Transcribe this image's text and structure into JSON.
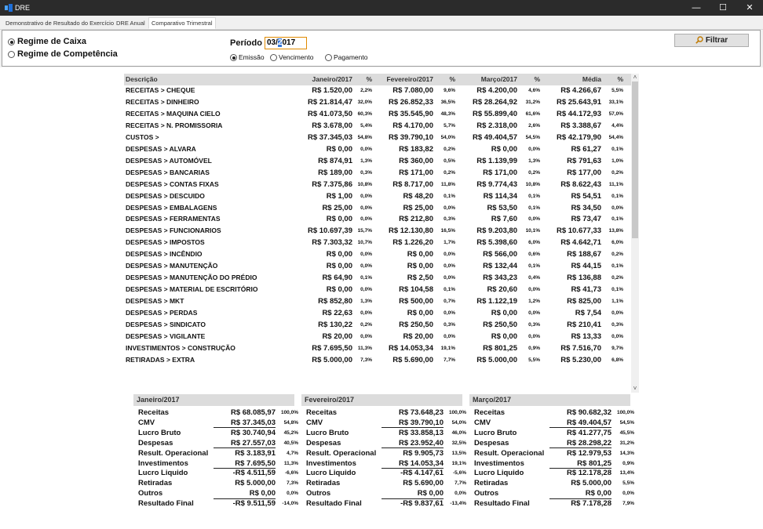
{
  "window": {
    "title": "DRE",
    "minimize": "—",
    "maximize": "☐",
    "close": "✕"
  },
  "tabs": [
    "Demonstrativo de Resultado do Exercício",
    "DRE Anual",
    "Comparativo Trimestral"
  ],
  "filters": {
    "regime_caixa": "Regime de Caixa",
    "regime_competencia": "Regime de Competência",
    "periodo_label": "Período",
    "periodo_value_a": "03/",
    "periodo_value_sel": "2",
    "periodo_value_b": "017",
    "emissao": "Emissão",
    "vencimento": "Vencimento",
    "pagamento": "Pagamento",
    "filtrar": "Filtrar"
  },
  "grid": {
    "headers": [
      "Descrição",
      "Janeiro/2017",
      "%",
      "Fevereiro/2017",
      "%",
      "Março/2017",
      "%",
      "Média",
      "%"
    ],
    "rows": [
      [
        "RECEITAS > CHEQUE",
        "R$ 1.520,00",
        "2,2%",
        "R$ 7.080,00",
        "9,6%",
        "R$ 4.200,00",
        "4,6%",
        "R$ 4.266,67",
        "5,5%"
      ],
      [
        "RECEITAS > DINHEIRO",
        "R$ 21.814,47",
        "32,0%",
        "R$ 26.852,33",
        "36,5%",
        "R$ 28.264,92",
        "31,2%",
        "R$ 25.643,91",
        "33,1%"
      ],
      [
        "RECEITAS > MAQUINA CIELO",
        "R$ 41.073,50",
        "60,3%",
        "R$ 35.545,90",
        "48,3%",
        "R$ 55.899,40",
        "61,6%",
        "R$ 44.172,93",
        "57,0%"
      ],
      [
        "RECEITAS > N. PROMISSORIA",
        "R$ 3.678,00",
        "5,4%",
        "R$ 4.170,00",
        "5,7%",
        "R$ 2.318,00",
        "2,6%",
        "R$ 3.388,67",
        "4,4%"
      ],
      [
        "CUSTOS >",
        "R$ 37.345,03",
        "54,8%",
        "R$ 39.790,10",
        "54,0%",
        "R$ 49.404,57",
        "54,5%",
        "R$ 42.179,90",
        "54,4%"
      ],
      [
        "DESPESAS > ALVARA",
        "R$ 0,00",
        "0,0%",
        "R$ 183,82",
        "0,2%",
        "R$ 0,00",
        "0,0%",
        "R$ 61,27",
        "0,1%"
      ],
      [
        "DESPESAS > AUTOMÓVEL",
        "R$ 874,91",
        "1,3%",
        "R$ 360,00",
        "0,5%",
        "R$ 1.139,99",
        "1,3%",
        "R$ 791,63",
        "1,0%"
      ],
      [
        "DESPESAS > BANCARIAS",
        "R$ 189,00",
        "0,3%",
        "R$ 171,00",
        "0,2%",
        "R$ 171,00",
        "0,2%",
        "R$ 177,00",
        "0,2%"
      ],
      [
        "DESPESAS > CONTAS FIXAS",
        "R$ 7.375,86",
        "10,8%",
        "R$ 8.717,00",
        "11,8%",
        "R$ 9.774,43",
        "10,8%",
        "R$ 8.622,43",
        "11,1%"
      ],
      [
        "DESPESAS > DESCUIDO",
        "R$ 1,00",
        "0,0%",
        "R$ 48,20",
        "0,1%",
        "R$ 114,34",
        "0,1%",
        "R$ 54,51",
        "0,1%"
      ],
      [
        "DESPESAS > EMBALAGENS",
        "R$ 25,00",
        "0,0%",
        "R$ 25,00",
        "0,0%",
        "R$ 53,50",
        "0,1%",
        "R$ 34,50",
        "0,0%"
      ],
      [
        "DESPESAS > FERRAMENTAS",
        "R$ 0,00",
        "0,0%",
        "R$ 212,80",
        "0,3%",
        "R$ 7,60",
        "0,0%",
        "R$ 73,47",
        "0,1%"
      ],
      [
        "DESPESAS > FUNCIONARIOS",
        "R$ 10.697,39",
        "15,7%",
        "R$ 12.130,80",
        "16,5%",
        "R$ 9.203,80",
        "10,1%",
        "R$ 10.677,33",
        "13,8%"
      ],
      [
        "DESPESAS > IMPOSTOS",
        "R$ 7.303,32",
        "10,7%",
        "R$ 1.226,20",
        "1,7%",
        "R$ 5.398,60",
        "6,0%",
        "R$ 4.642,71",
        "6,0%"
      ],
      [
        "DESPESAS > INCÊNDIO",
        "R$ 0,00",
        "0,0%",
        "R$ 0,00",
        "0,0%",
        "R$ 566,00",
        "0,6%",
        "R$ 188,67",
        "0,2%"
      ],
      [
        "DESPESAS > MANUTENÇÃO",
        "R$ 0,00",
        "0,0%",
        "R$ 0,00",
        "0,0%",
        "R$ 132,44",
        "0,1%",
        "R$ 44,15",
        "0,1%"
      ],
      [
        "DESPESAS > MANUTENÇÃO DO PRÉDIO",
        "R$ 64,90",
        "0,1%",
        "R$ 2,50",
        "0,0%",
        "R$ 343,23",
        "0,4%",
        "R$ 136,88",
        "0,2%"
      ],
      [
        "DESPESAS > MATERIAL DE ESCRITÓRIO",
        "R$ 0,00",
        "0,0%",
        "R$ 104,58",
        "0,1%",
        "R$ 20,60",
        "0,0%",
        "R$ 41,73",
        "0,1%"
      ],
      [
        "DESPESAS > MKT",
        "R$ 852,80",
        "1,3%",
        "R$ 500,00",
        "0,7%",
        "R$ 1.122,19",
        "1,2%",
        "R$ 825,00",
        "1,1%"
      ],
      [
        "DESPESAS > PERDAS",
        "R$ 22,63",
        "0,0%",
        "R$ 0,00",
        "0,0%",
        "R$ 0,00",
        "0,0%",
        "R$ 7,54",
        "0,0%"
      ],
      [
        "DESPESAS > SINDICATO",
        "R$ 130,22",
        "0,2%",
        "R$ 250,50",
        "0,3%",
        "R$ 250,50",
        "0,3%",
        "R$ 210,41",
        "0,3%"
      ],
      [
        "DESPESAS > VIGILANTE",
        "R$ 20,00",
        "0,0%",
        "R$ 20,00",
        "0,0%",
        "R$ 0,00",
        "0,0%",
        "R$ 13,33",
        "0,0%"
      ],
      [
        "INVESTIMENTOS > CONSTRUÇÃO",
        "R$ 7.695,50",
        "11,3%",
        "R$ 14.053,34",
        "19,1%",
        "R$ 801,25",
        "0,9%",
        "R$ 7.516,70",
        "9,7%"
      ],
      [
        "RETIRADAS > EXTRA",
        "R$ 5.000,00",
        "7,3%",
        "R$ 5.690,00",
        "7,7%",
        "R$ 5.000,00",
        "5,5%",
        "R$ 5.230,00",
        "6,8%"
      ]
    ]
  },
  "summary_labels": [
    "Receitas",
    "CMV",
    "Lucro Bruto",
    "Despesas",
    "Result. Operacional",
    "Investimentos",
    "Lucro Liquido",
    "Retiradas",
    "Outros",
    "Resultado Final"
  ],
  "summaries": [
    {
      "title": "Janeiro/2017",
      "values": [
        "R$ 68.085,97",
        "R$ 37.345,03",
        "R$ 30.740,94",
        "R$ 27.557,03",
        "R$ 3.183,91",
        "R$ 7.695,50",
        "-R$ 4.511,59",
        "R$ 5.000,00",
        "R$ 0,00",
        "-R$ 9.511,59"
      ],
      "pcts": [
        "100,0%",
        "54,8%",
        "45,2%",
        "40,5%",
        "4,7%",
        "11,3%",
        "-6,6%",
        "7,3%",
        "0,0%",
        "-14,0%"
      ]
    },
    {
      "title": "Fevereiro/2017",
      "values": [
        "R$ 73.648,23",
        "R$ 39.790,10",
        "R$ 33.858,13",
        "R$ 23.952,40",
        "R$ 9.905,73",
        "R$ 14.053,34",
        "-R$ 4.147,61",
        "R$ 5.690,00",
        "R$ 0,00",
        "-R$ 9.837,61"
      ],
      "pcts": [
        "100,0%",
        "54,0%",
        "46,0%",
        "32,5%",
        "13,5%",
        "19,1%",
        "-5,6%",
        "7,7%",
        "0,0%",
        "-13,4%"
      ]
    },
    {
      "title": "Março/2017",
      "values": [
        "R$ 90.682,32",
        "R$ 49.404,57",
        "R$ 41.277,75",
        "R$ 28.298,22",
        "R$ 12.979,53",
        "R$ 801,25",
        "R$ 12.178,28",
        "R$ 5.000,00",
        "R$ 0,00",
        "R$ 7.178,28"
      ],
      "pcts": [
        "100,0%",
        "54,5%",
        "45,5%",
        "31,2%",
        "14,3%",
        "0,9%",
        "13,4%",
        "5,5%",
        "0,0%",
        "7,9%"
      ]
    }
  ]
}
